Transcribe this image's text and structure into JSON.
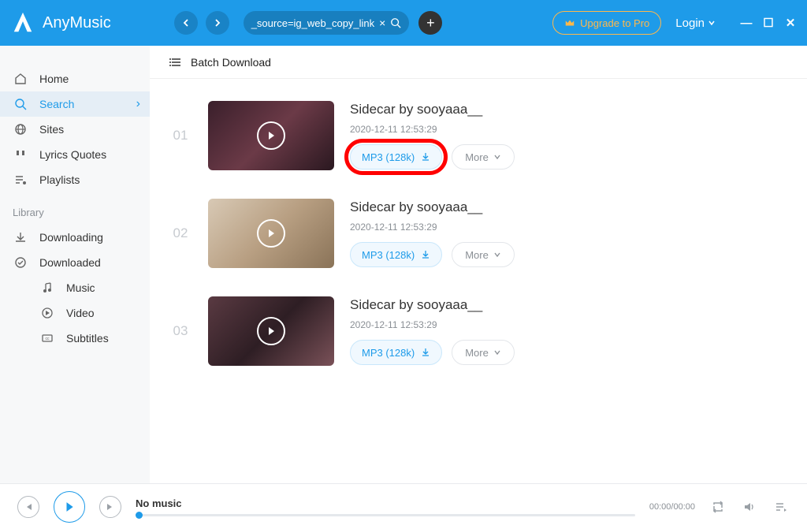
{
  "app": {
    "name": "AnyMusic"
  },
  "header": {
    "search_text": "_source=ig_web_copy_link",
    "upgrade_label": "Upgrade to Pro",
    "login_label": "Login"
  },
  "sidebar": {
    "items": [
      {
        "label": "Home"
      },
      {
        "label": "Search"
      },
      {
        "label": "Sites"
      },
      {
        "label": "Lyrics Quotes"
      },
      {
        "label": "Playlists"
      }
    ],
    "library_label": "Library",
    "library": [
      {
        "label": "Downloading"
      },
      {
        "label": "Downloaded"
      }
    ],
    "sub": [
      {
        "label": "Music"
      },
      {
        "label": "Video"
      },
      {
        "label": "Subtitles"
      }
    ]
  },
  "main": {
    "batch_label": "Batch Download",
    "rows": [
      {
        "num": "01",
        "title": "Sidecar by sooyaaa__",
        "date": "2020-12-11 12:53:29",
        "mp3": "MP3 (128k)",
        "more": "More"
      },
      {
        "num": "02",
        "title": "Sidecar by sooyaaa__",
        "date": "2020-12-11 12:53:29",
        "mp3": "MP3 (128k)",
        "more": "More"
      },
      {
        "num": "03",
        "title": "Sidecar by sooyaaa__",
        "date": "2020-12-11 12:53:29",
        "mp3": "MP3 (128k)",
        "more": "More"
      }
    ]
  },
  "player": {
    "title": "No music",
    "time": "00:00/00:00"
  }
}
